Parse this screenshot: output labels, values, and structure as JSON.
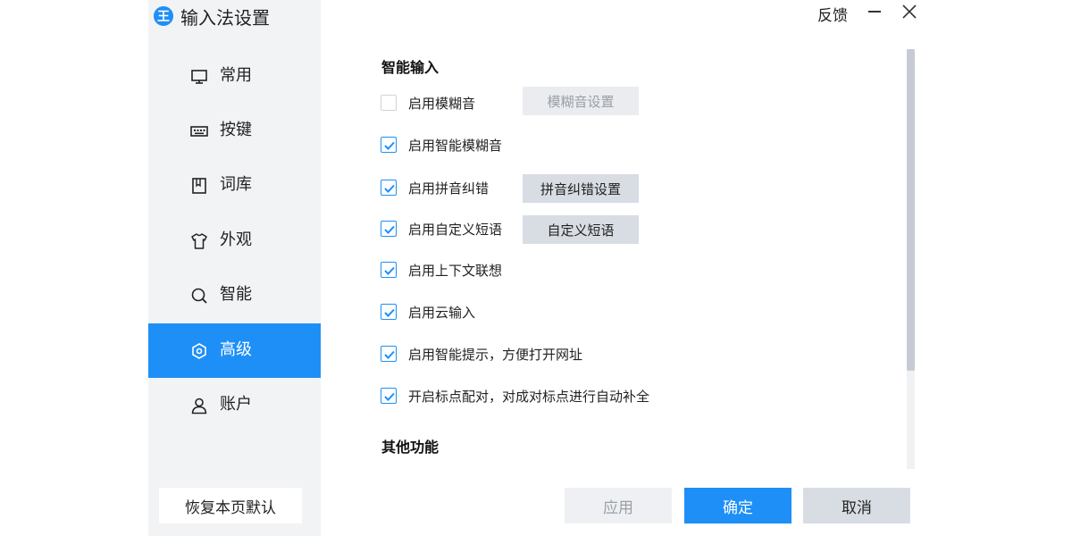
{
  "window": {
    "title": "输入法设置",
    "logo_glyph": "王",
    "feedback": "反馈"
  },
  "colors": {
    "accent": "#1e8ff7",
    "sidebar_bg": "#f2f3f5",
    "button_gray": "#d8dde4"
  },
  "sidebar": {
    "items": [
      {
        "label": "常用",
        "icon": "monitor-icon",
        "active": false
      },
      {
        "label": "按键",
        "icon": "keyboard-icon",
        "active": false
      },
      {
        "label": "词库",
        "icon": "book-icon",
        "active": false
      },
      {
        "label": "外观",
        "icon": "shirt-icon",
        "active": false
      },
      {
        "label": "智能",
        "icon": "search-icon",
        "active": false
      },
      {
        "label": "高级",
        "icon": "hexagon-settings-icon",
        "active": true
      },
      {
        "label": "账户",
        "icon": "user-icon",
        "active": false
      }
    ],
    "restore_label": "恢复本页默认"
  },
  "content": {
    "section1_title": "智能输入",
    "options": [
      {
        "label": "启用模糊音",
        "checked": false,
        "button": "模糊音设置",
        "button_enabled": false
      },
      {
        "label": "启用智能模糊音",
        "checked": true
      },
      {
        "label": "启用拼音纠错",
        "checked": true,
        "button": "拼音纠错设置",
        "button_enabled": true
      },
      {
        "label": "启用自定义短语",
        "checked": true,
        "button": "自定义短语",
        "button_enabled": true
      },
      {
        "label": "启用上下文联想",
        "checked": true
      },
      {
        "label": "启用云输入",
        "checked": true
      },
      {
        "label": "启用智能提示，方便打开网址",
        "checked": true
      },
      {
        "label": "开启标点配对，对成对标点进行自动补全",
        "checked": true
      }
    ],
    "section2_title": "其他功能"
  },
  "footer": {
    "apply": "应用",
    "ok": "确定",
    "cancel": "取消"
  }
}
